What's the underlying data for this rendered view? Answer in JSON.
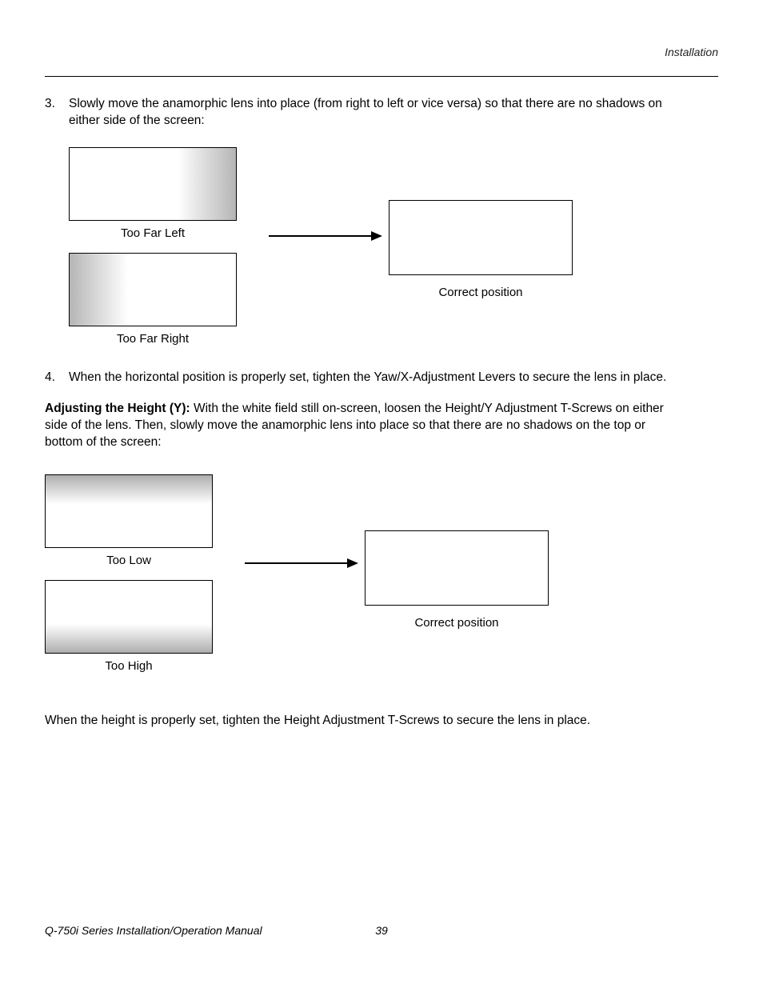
{
  "header": {
    "section": "Installation"
  },
  "list": {
    "item3": {
      "num": "3.",
      "text": "Slowly move the anamorphic lens into place (from right to left or vice versa) so that there are no shadows on either side of the screen:"
    },
    "item4": {
      "num": "4.",
      "text": "When the horizontal position is properly set, tighten the Yaw/X-Adjustment Levers to secure the lens in place."
    }
  },
  "diagram_x": {
    "too_far_left": "Too Far Left",
    "too_far_right": "Too Far Right",
    "correct": "Correct position"
  },
  "height_para": {
    "bold": "Adjusting the Height (Y): ",
    "rest": "With the white field still on-screen, loosen the Height/Y Adjustment T-Screws on either side of the lens. Then, slowly move the anamorphic lens into place so that there are no shadows on the top or bottom of the screen:"
  },
  "diagram_y": {
    "too_low": "Too Low",
    "too_high": "Too High",
    "correct": "Correct position"
  },
  "closing": "When the height is properly set, tighten the Height Adjustment T-Screws to secure the lens in place.",
  "footer": {
    "title": "Q-750i Series Installation/Operation Manual",
    "page": "39"
  }
}
